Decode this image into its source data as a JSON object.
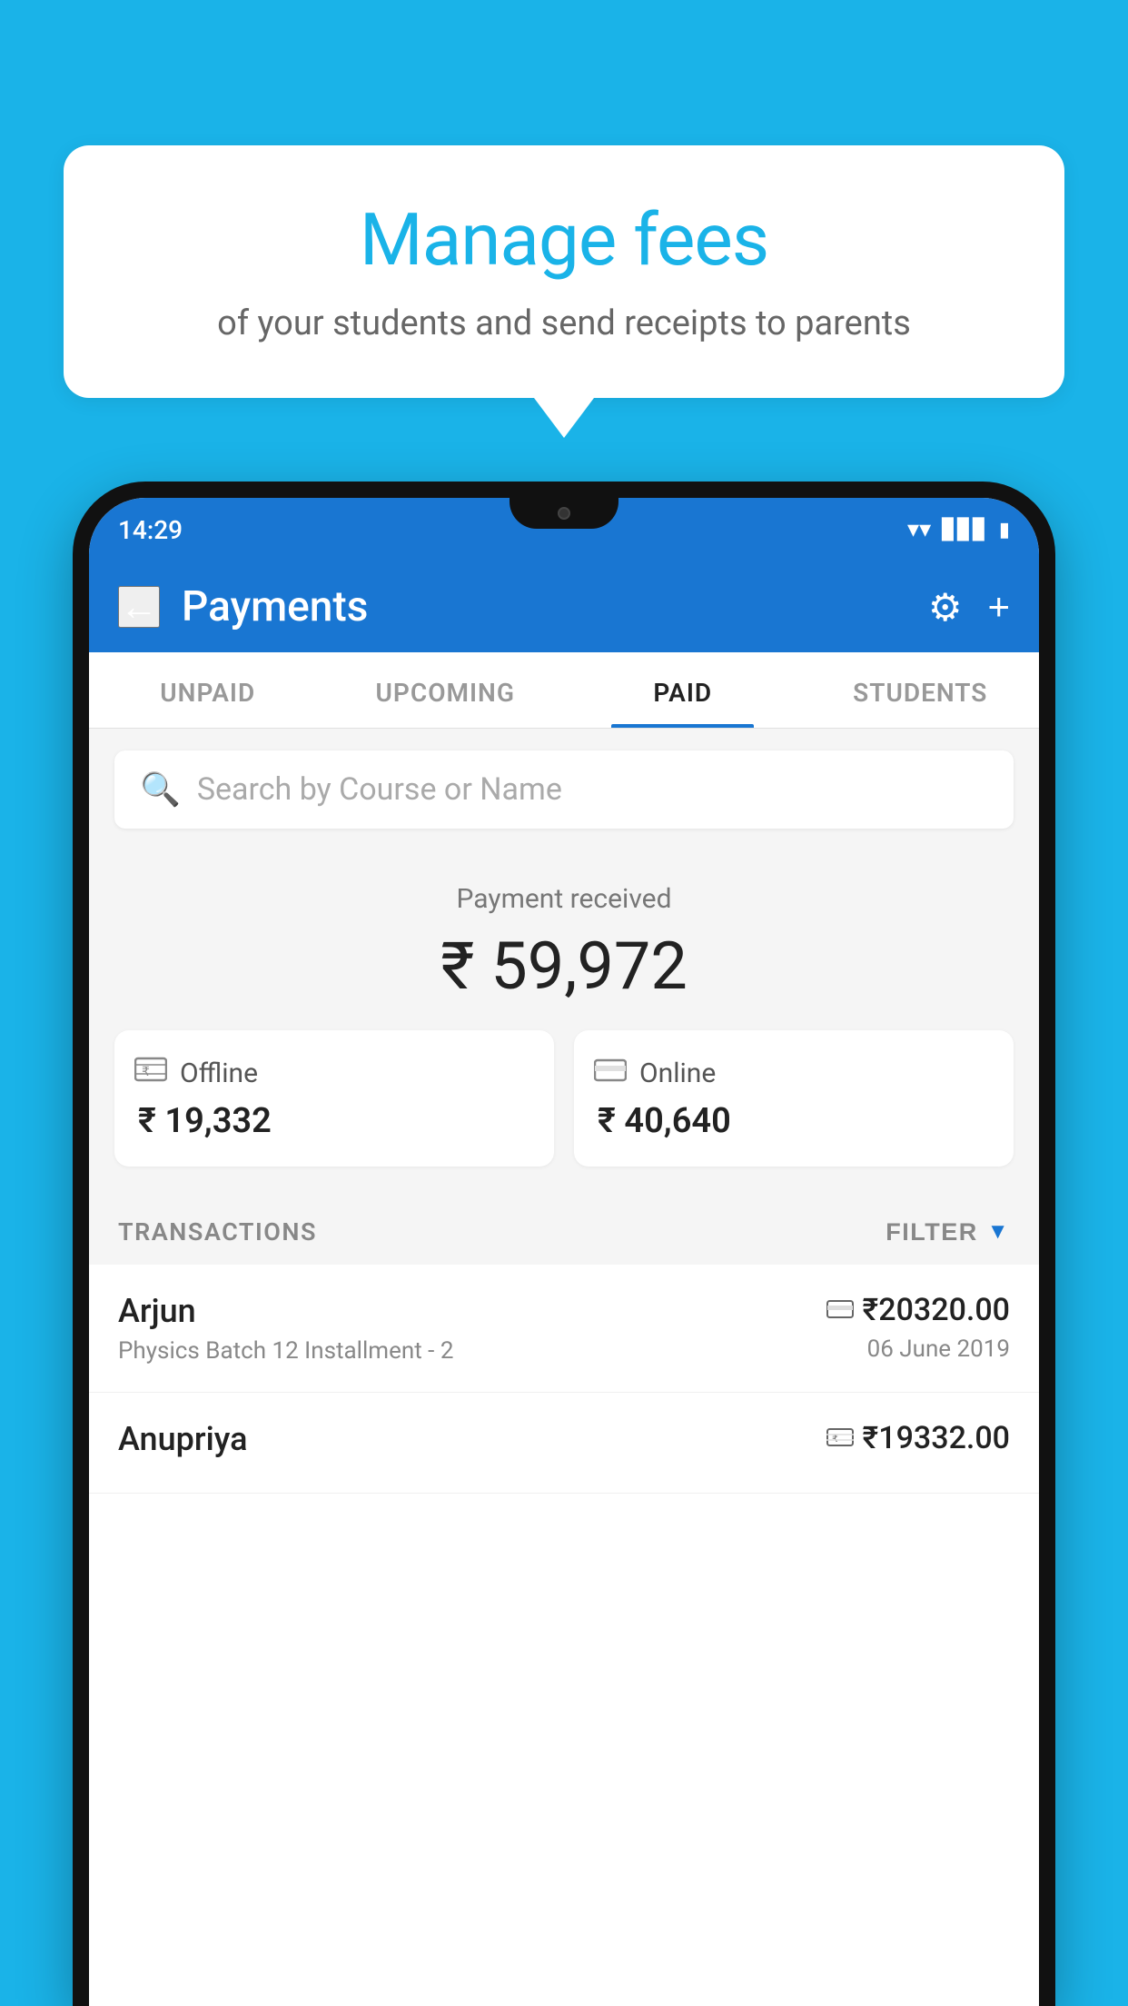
{
  "bubble": {
    "title": "Manage fees",
    "subtitle": "of your students and send receipts to parents"
  },
  "status_bar": {
    "time": "14:29"
  },
  "header": {
    "title": "Payments",
    "back_label": "←",
    "gear_label": "⚙",
    "plus_label": "+"
  },
  "tabs": [
    {
      "id": "unpaid",
      "label": "UNPAID",
      "active": false
    },
    {
      "id": "upcoming",
      "label": "UPCOMING",
      "active": false
    },
    {
      "id": "paid",
      "label": "PAID",
      "active": true
    },
    {
      "id": "students",
      "label": "STUDENTS",
      "active": false
    }
  ],
  "search": {
    "placeholder": "Search by Course or Name"
  },
  "payment_summary": {
    "label": "Payment received",
    "amount": "₹ 59,972",
    "offline": {
      "icon": "💳",
      "label": "Offline",
      "amount": "₹ 19,332"
    },
    "online": {
      "icon": "💳",
      "label": "Online",
      "amount": "₹ 40,640"
    }
  },
  "transactions": {
    "section_label": "TRANSACTIONS",
    "filter_label": "FILTER",
    "rows": [
      {
        "name": "Arjun",
        "description": "Physics Batch 12 Installment - 2",
        "amount": "₹20320.00",
        "date": "06 June 2019",
        "type": "online"
      },
      {
        "name": "Anupriya",
        "description": "",
        "amount": "₹19332.00",
        "date": "",
        "type": "offline"
      }
    ]
  }
}
